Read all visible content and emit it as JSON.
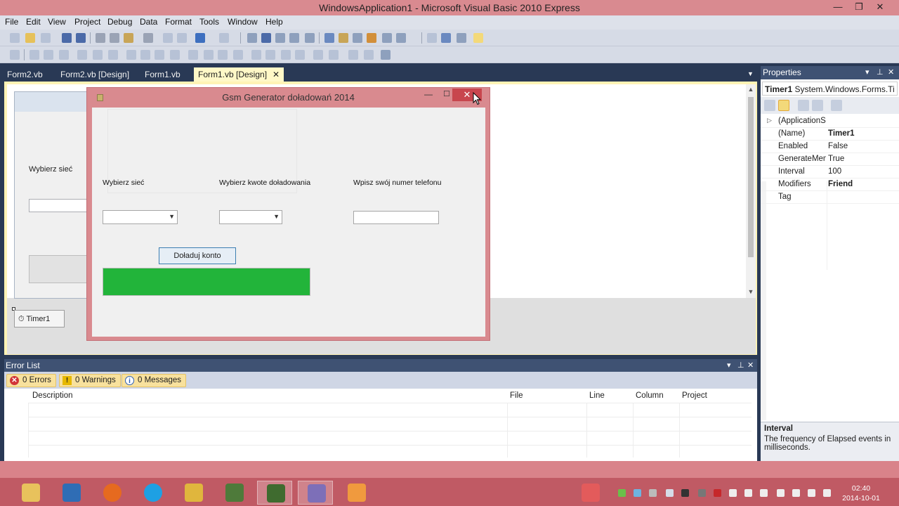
{
  "window": {
    "title": "WindowsApplication1 - Microsoft Visual Basic 2010 Express",
    "controls": {
      "minimize": "—",
      "restore": "❐",
      "close": "✕"
    }
  },
  "menu": [
    "File",
    "Edit",
    "View",
    "Project",
    "Debug",
    "Data",
    "Format",
    "Tools",
    "Window",
    "Help"
  ],
  "doc_tabs": [
    {
      "label": "Form2.vb",
      "active": false
    },
    {
      "label": "Form2.vb [Design]",
      "active": false
    },
    {
      "label": "Form1.vb",
      "active": false
    },
    {
      "label": "Form1.vb [Design]",
      "active": true
    }
  ],
  "tab_close": "✕",
  "background_form": {
    "label": "Wybierz sieć"
  },
  "component_tray": {
    "timer_label": "Timer1"
  },
  "app_window": {
    "title": "Gsm Generator doładowań 2014",
    "labels": {
      "network": "Wybierz sieć",
      "amount": "Wybierz kwote doładowania",
      "phone": "Wpisz swój numer telefonu"
    },
    "network_select": "",
    "amount_select": "",
    "phone_value": "",
    "button": "Doładuj konto",
    "progress": 1.0,
    "progress_color": "#22b43a",
    "controls": {
      "minimize": "—",
      "maximize": "☐",
      "close": "✕"
    }
  },
  "properties": {
    "title": "Properties",
    "object_name": "Timer1",
    "object_type": "System.Windows.Forms.Ti",
    "rows": [
      {
        "name": "(ApplicationS",
        "value": "",
        "expandable": true,
        "bold": false
      },
      {
        "name": "(Name)",
        "value": "Timer1",
        "expandable": false,
        "bold": true
      },
      {
        "name": "Enabled",
        "value": "False",
        "expandable": false,
        "bold": false
      },
      {
        "name": "GenerateMem",
        "value": "True",
        "expandable": false,
        "bold": false
      },
      {
        "name": "Interval",
        "value": "100",
        "expandable": false,
        "bold": false
      },
      {
        "name": "Modifiers",
        "value": "Friend",
        "expandable": false,
        "bold": true
      },
      {
        "name": "Tag",
        "value": "",
        "expandable": false,
        "bold": false
      }
    ],
    "description_title": "Interval",
    "description_text": "The frequency of Elapsed events in milliseconds."
  },
  "error_list": {
    "title": "Error List",
    "filters": {
      "errors": "0 Errors",
      "warnings": "0 Warnings",
      "messages": "0 Messages"
    },
    "columns": [
      "Description",
      "File",
      "Line",
      "Column",
      "Project"
    ]
  },
  "taskbar": {
    "apps": [
      "file-explorer",
      "this-pc",
      "firefox",
      "skype",
      "winamp",
      "minecraft",
      "minecraft-server",
      "visual-basic",
      "app-generic"
    ],
    "clock_time": "02:40",
    "clock_date": "2014-10-01"
  },
  "colors": {
    "accent_window": "#d98a90",
    "ide_dark": "#293955",
    "panel_header": "#3f5273",
    "active_tab": "#fff8c7",
    "taskbar": "#c05a64"
  }
}
